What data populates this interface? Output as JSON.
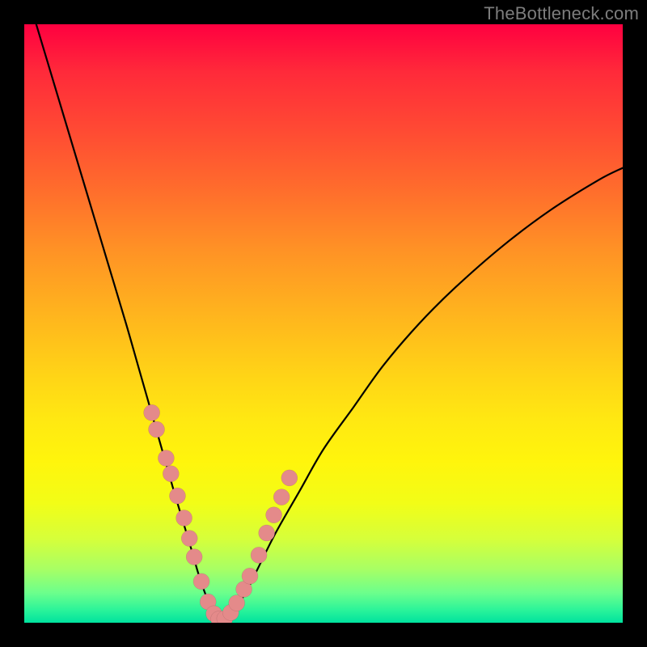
{
  "watermark": {
    "text": "TheBottleneck.com"
  },
  "chart_data": {
    "type": "line",
    "title": "",
    "xlabel": "",
    "ylabel": "",
    "xlim": [
      0,
      100
    ],
    "ylim": [
      0,
      100
    ],
    "grid": false,
    "legend": false,
    "series": [
      {
        "name": "curve",
        "x": [
          2,
          5,
          8,
          11,
          14,
          17,
          19,
          21,
          23,
          25,
          26.5,
          28,
          29,
          30,
          31,
          32,
          33,
          34,
          35,
          37,
          39,
          42,
          46,
          50,
          55,
          60,
          66,
          72,
          80,
          88,
          96,
          100
        ],
        "y": [
          100,
          90,
          80,
          70,
          60,
          50,
          43,
          36,
          29,
          22,
          17,
          12,
          8.5,
          5.5,
          3,
          1.3,
          0.5,
          0.8,
          2,
          5,
          9,
          15,
          22,
          29,
          36,
          43,
          50,
          56,
          63,
          69,
          74,
          76
        ]
      }
    ],
    "markers": {
      "name": "highlight-dots",
      "x": [
        21.3,
        22.1,
        23.7,
        24.5,
        25.6,
        26.7,
        27.6,
        28.4,
        29.6,
        30.7,
        31.7,
        32.5,
        33.5,
        34.5,
        35.5,
        36.7,
        37.7,
        39.2,
        40.5,
        41.7,
        43.0,
        44.3
      ],
      "y": [
        35.1,
        32.3,
        27.5,
        24.9,
        21.2,
        17.5,
        14.1,
        11.0,
        6.9,
        3.5,
        1.5,
        0.6,
        0.7,
        1.7,
        3.3,
        5.6,
        7.8,
        11.3,
        15.0,
        18.0,
        21.0,
        24.2
      ]
    },
    "marker_radius_px": 10,
    "background_gradient": {
      "top": "#ff0040",
      "middle": "#ffd217",
      "bottom": "#00e29e"
    },
    "curve_color": "#000000",
    "marker_color": "#e48a8a"
  }
}
